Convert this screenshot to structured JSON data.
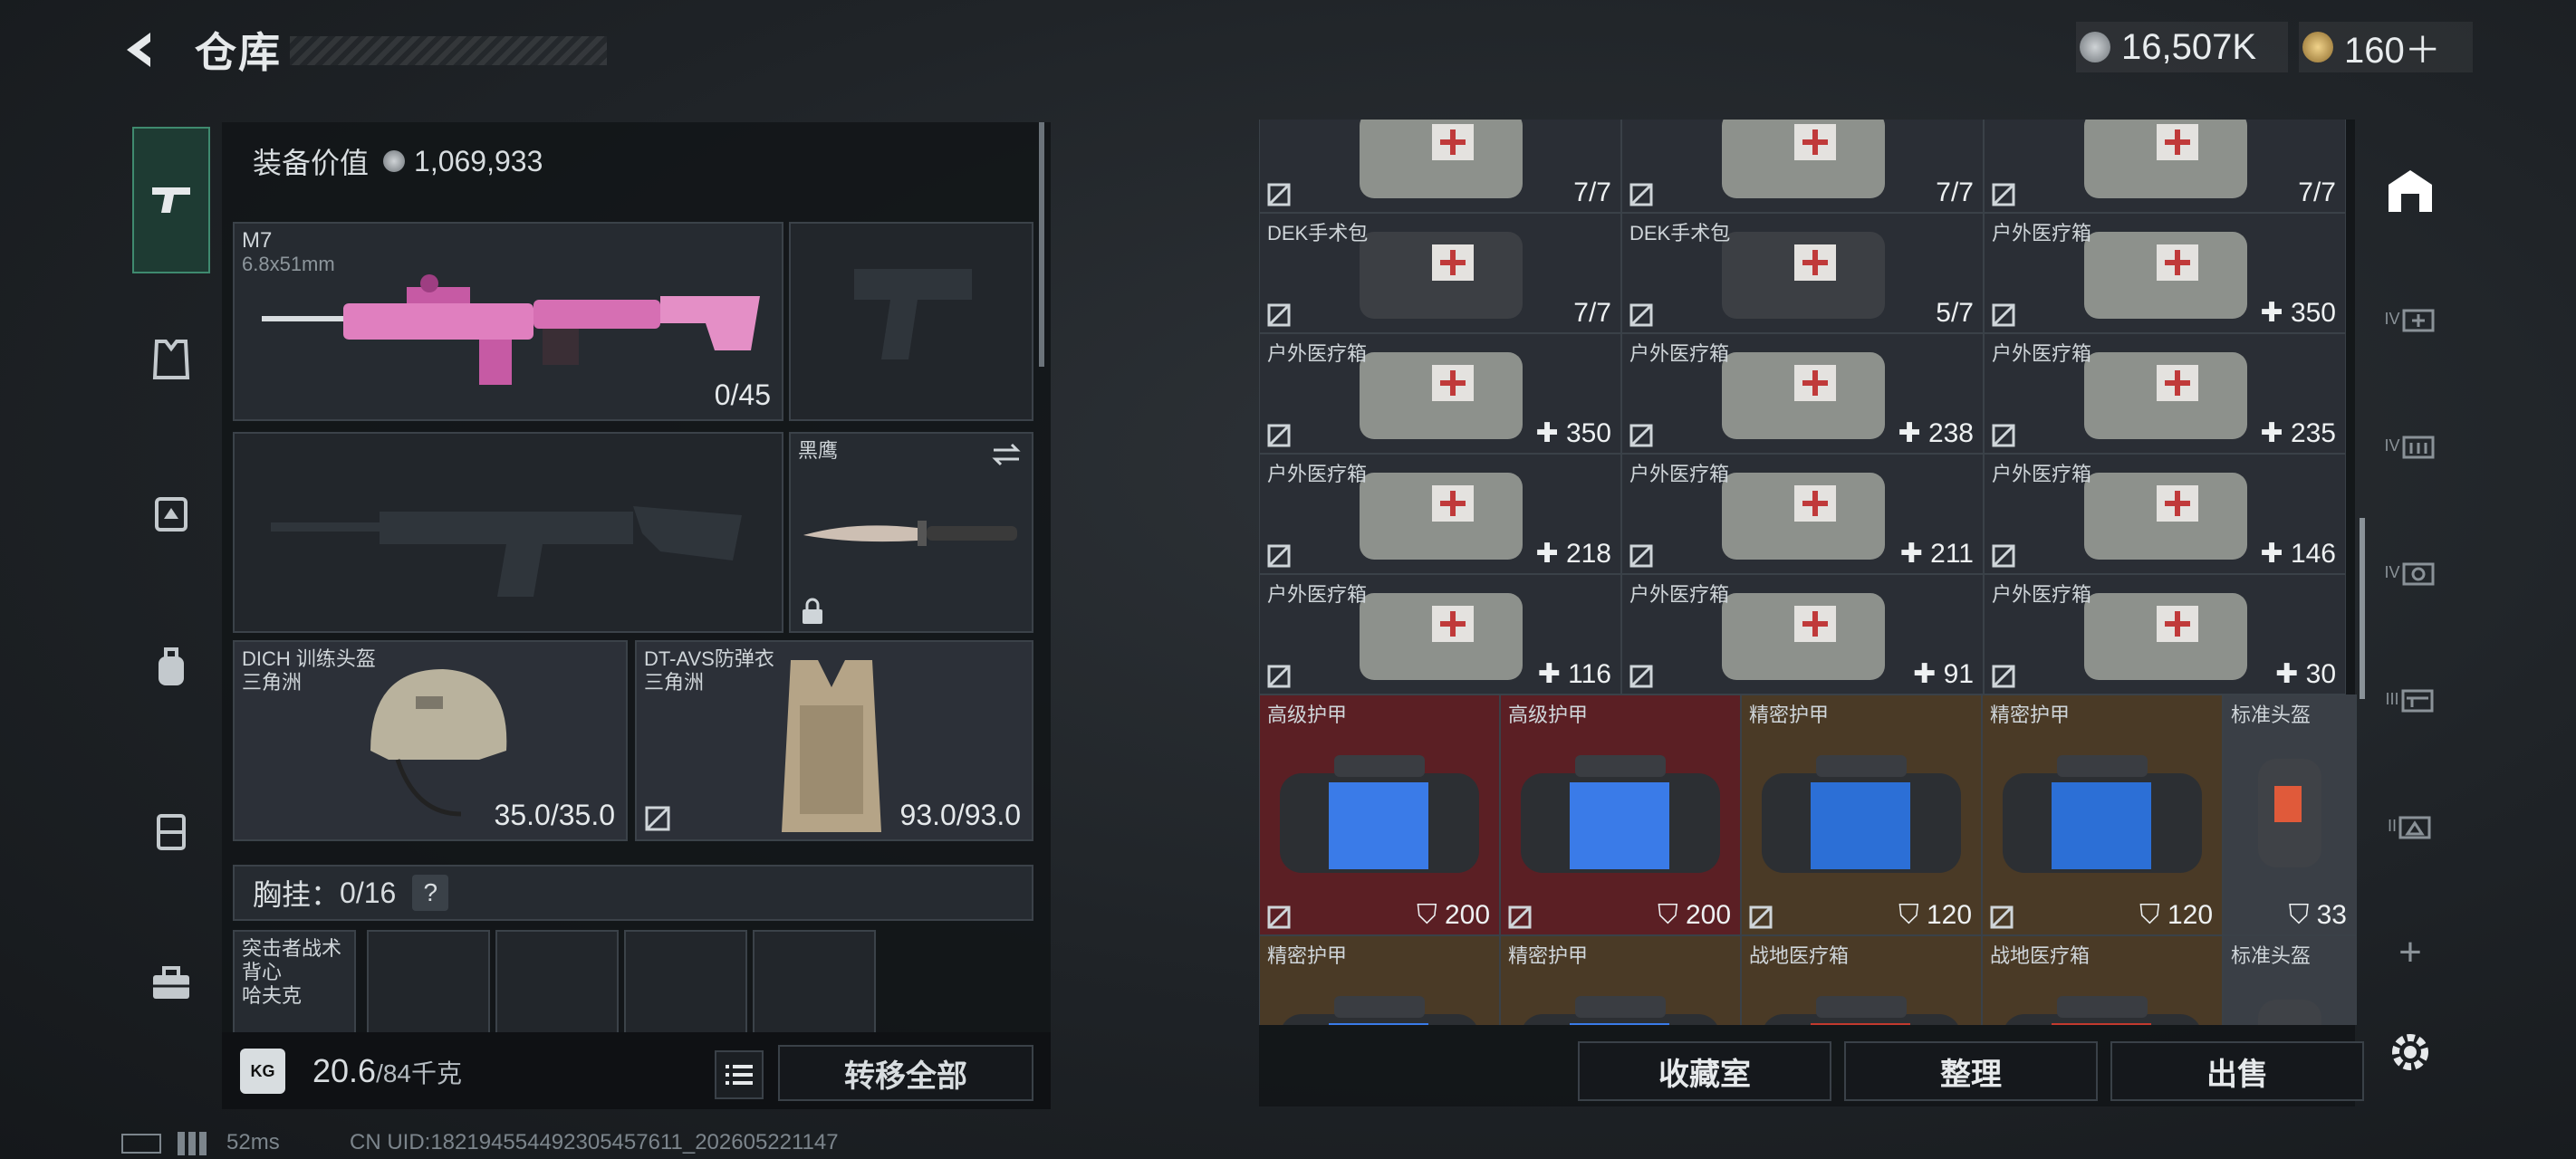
{
  "header": {
    "title": "仓库",
    "currency_silver": "16,507K",
    "currency_gold": "160＋"
  },
  "loadout": {
    "value_label": "装备价值",
    "value": "1,069,933",
    "primary": {
      "name": "M7",
      "caliber": "6.8x51mm",
      "ammo": "0/45"
    },
    "melee": {
      "name": "黑鹰"
    },
    "helmet": {
      "name": "DICH 训练头盔",
      "origin": "三角洲",
      "durability": "35.0/35.0"
    },
    "armor": {
      "name": "DT-AVS防弹衣",
      "origin": "三角洲",
      "durability": "93.0/93.0"
    },
    "rig": {
      "label": "胸挂：",
      "capacity": "0/16",
      "help": "?"
    },
    "backpack": {
      "name": "突击者战术背心",
      "origin": "哈夫克"
    },
    "weight": {
      "current": "20.6",
      "max": "/84千克",
      "icon": "KG"
    },
    "transfer_all": "转移全部"
  },
  "stash": {
    "rows": [
      [
        {
          "name": "",
          "qty": "7/7"
        },
        {
          "name": "",
          "qty": "7/7"
        },
        {
          "name": "",
          "qty": "7/7"
        }
      ],
      [
        {
          "name": "DEK手术包",
          "qty": "7/7"
        },
        {
          "name": "DEK手术包",
          "qty": "5/7"
        },
        {
          "name": "户外医疗箱",
          "qty": "350"
        }
      ],
      [
        {
          "name": "户外医疗箱",
          "qty": "350"
        },
        {
          "name": "户外医疗箱",
          "qty": "238"
        },
        {
          "name": "户外医疗箱",
          "qty": "235"
        }
      ],
      [
        {
          "name": "户外医疗箱",
          "qty": "218"
        },
        {
          "name": "户外医疗箱",
          "qty": "211"
        },
        {
          "name": "户外医疗箱",
          "qty": "146"
        }
      ],
      [
        {
          "name": "户外医疗箱",
          "qty": "116"
        },
        {
          "name": "户外医疗箱",
          "qty": "91"
        },
        {
          "name": "户外医疗箱",
          "qty": "30"
        }
      ]
    ],
    "armor_row": [
      {
        "name": "高级护甲",
        "qty": "200"
      },
      {
        "name": "高级护甲",
        "qty": "200"
      },
      {
        "name": "精密护甲",
        "qty": "120"
      },
      {
        "name": "精密护甲",
        "qty": "120"
      },
      {
        "name": "标准头盔",
        "qty": "33"
      }
    ],
    "last_row": [
      {
        "name": "精密护甲"
      },
      {
        "name": "精密护甲"
      },
      {
        "name": "战地医疗箱"
      },
      {
        "name": "战地医疗箱"
      },
      {
        "name": "标准头盔"
      }
    ],
    "buttons": {
      "collection": "收藏室",
      "sort": "整理",
      "sell": "出售"
    }
  },
  "right_rail": {
    "tabs": [
      "IV",
      "IV",
      "IV",
      "III",
      "II"
    ],
    "add": "+"
  },
  "status": {
    "ping": "52ms",
    "uid": "CN UID:18219455449230545761​1_202605221147"
  },
  "colors": {
    "accent": "#3f8a6f",
    "rare_red": "#5b1f24",
    "rare_gold": "#4a3a26"
  }
}
